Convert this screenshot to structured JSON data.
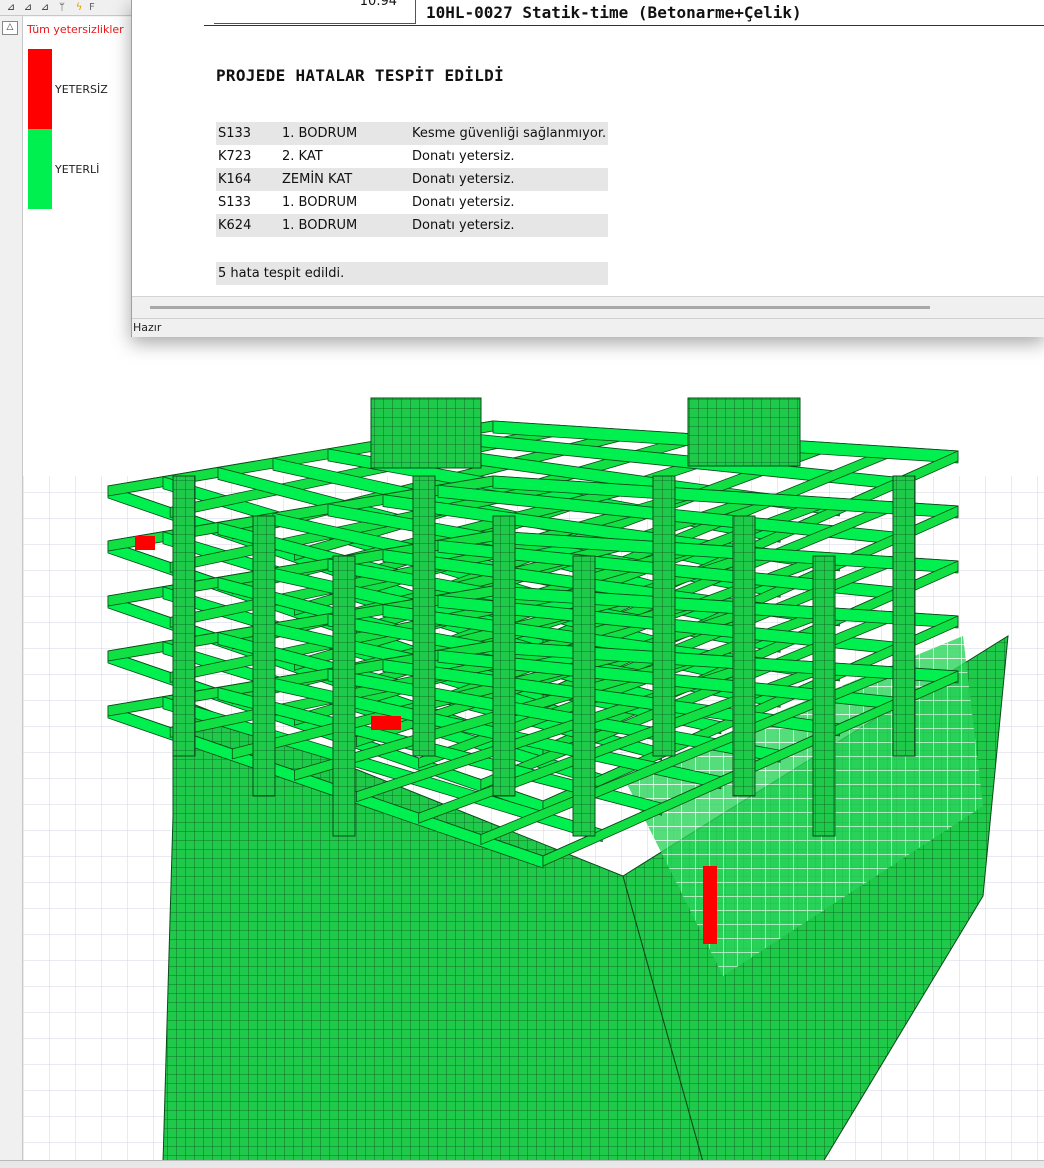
{
  "toolbar": {
    "icons": [
      "chart-icon",
      "chart-edit-icon",
      "chart-export-icon",
      "graph-icon",
      "lightning-icon"
    ],
    "overflow_label": "F"
  },
  "legend": {
    "title": "Tüm yetersizlikler",
    "items": [
      {
        "label": "YETERSİZ",
        "color": "#ff0000"
      },
      {
        "label": "YETERLİ",
        "color": "#00f050"
      }
    ]
  },
  "report": {
    "header_value": "10.94",
    "header_title": "10HL-0027 Statik-time (Betonarme+Çelik)",
    "title": "PROJEDE HATALAR TESPİT EDİLDİ",
    "errors": [
      {
        "element": "S133",
        "floor": "1. BODRUM",
        "message": "Kesme güvenliği sağlanmıyor."
      },
      {
        "element": "K723",
        "floor": "2. KAT",
        "message": "Donatı yetersiz."
      },
      {
        "element": "K164",
        "floor": "ZEMİN KAT",
        "message": "Donatı yetersiz."
      },
      {
        "element": "S133",
        "floor": "1. BODRUM",
        "message": "Donatı yetersiz."
      },
      {
        "element": "K624",
        "floor": "1. BODRUM",
        "message": "Donatı yetersiz."
      }
    ],
    "summary": "5 hata tespit edildi.",
    "status": "Hazır"
  },
  "viewport": {
    "adequate_color": "#00f050",
    "inadequate_color": "#ff0000",
    "model_floors": 5,
    "failing_members_shown": 3
  }
}
